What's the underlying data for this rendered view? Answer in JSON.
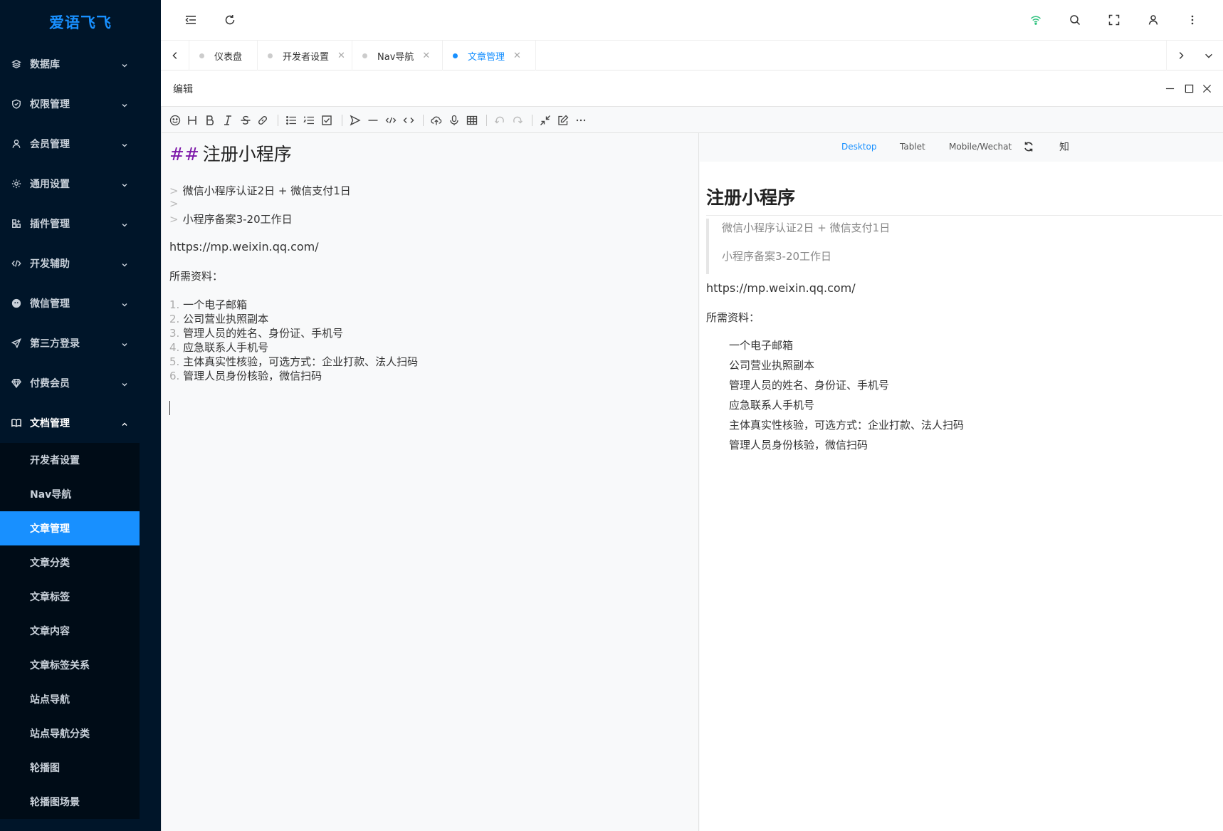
{
  "app": {
    "logo": "爱语飞飞"
  },
  "sidebar": {
    "items": [
      {
        "label": "数据库",
        "icon": "layers-icon"
      },
      {
        "label": "权限管理",
        "icon": "shield-icon"
      },
      {
        "label": "会员管理",
        "icon": "user-icon"
      },
      {
        "label": "通用设置",
        "icon": "gear-icon"
      },
      {
        "label": "插件管理",
        "icon": "plugin-icon"
      },
      {
        "label": "开发辅助",
        "icon": "code-icon"
      },
      {
        "label": "微信管理",
        "icon": "wechat-icon"
      },
      {
        "label": "第三方登录",
        "icon": "send-icon"
      },
      {
        "label": "付费会员",
        "icon": "diamond-icon"
      },
      {
        "label": "文档管理",
        "icon": "book-icon"
      }
    ],
    "submenu": [
      {
        "label": "开发者设置"
      },
      {
        "label": "Nav导航"
      },
      {
        "label": "文章管理",
        "active": true
      },
      {
        "label": "文章分类"
      },
      {
        "label": "文章标签"
      },
      {
        "label": "文章内容"
      },
      {
        "label": "文章标签关系"
      },
      {
        "label": "站点导航"
      },
      {
        "label": "站点导航分类"
      },
      {
        "label": "轮播图"
      },
      {
        "label": "轮播图场景"
      }
    ]
  },
  "tabs": [
    {
      "label": "仪表盘"
    },
    {
      "label": "开发者设置"
    },
    {
      "label": "Nav导航"
    },
    {
      "label": "文章管理"
    }
  ],
  "edit": {
    "title": "编辑"
  },
  "source": {
    "heading_marker": "##",
    "heading": "注册小程序",
    "quote_marker": ">",
    "quote1": "微信小程序认证2日 + 微信支付1日",
    "quote2": "小程序备案3-20工作日",
    "url": "https://mp.weixin.qq.com/",
    "materials": "所需资料：",
    "list": [
      {
        "num": "1.",
        "text": "一个电子邮箱"
      },
      {
        "num": "2.",
        "text": "公司营业执照副本"
      },
      {
        "num": "3.",
        "text": "管理人员的姓名、身份证、手机号"
      },
      {
        "num": "4.",
        "text": "应急联系人手机号"
      },
      {
        "num": "5.",
        "text": "主体真实性核验，可选方式：企业打款、法人扫码"
      },
      {
        "num": "6.",
        "text": "管理人员身份核验，微信扫码"
      }
    ]
  },
  "preview": {
    "modes": [
      "Desktop",
      "Tablet",
      "Mobile/Wechat"
    ],
    "active_mode": "Desktop",
    "zhi": "知",
    "heading": "注册小程序",
    "quote1": "微信小程序认证2日 + 微信支付1日",
    "quote2": "小程序备案3-20工作日",
    "url": "https://mp.weixin.qq.com/",
    "materials": "所需资料：",
    "list": [
      "一个电子邮箱",
      "公司营业执照副本",
      "管理人员的姓名、身份证、手机号",
      "应急联系人手机号",
      "主体真实性核验，可选方式：企业打款、法人扫码",
      "管理人员身份核验，微信扫码"
    ]
  },
  "colors": {
    "sidebar_bg": "#001529",
    "submenu_bg": "#000c17",
    "accent": "#1890ff",
    "wifi": "#2ec27e"
  }
}
